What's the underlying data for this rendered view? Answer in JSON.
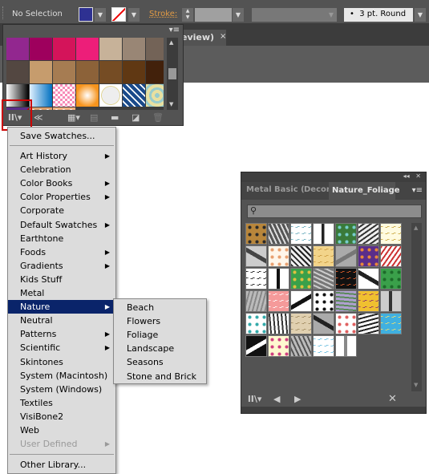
{
  "control_bar": {
    "selection": "No Selection",
    "fill_color": "#2e3192",
    "stroke_label": "Stroke:",
    "brush": "3 pt. Round"
  },
  "document_tab": {
    "title": "eview)",
    "close": "×"
  },
  "swatches_panel": {
    "colors": [
      "#92278f",
      "#9e005d",
      "#d4145a",
      "#ed1e79",
      "#c7b299",
      "#998675",
      "#736357",
      "#534741",
      "#c69c6d",
      "#a67c52",
      "#8c6239",
      "#754c24",
      "#603813",
      "#42210b"
    ],
    "patterns": [
      "gradient-bw",
      "gradient-blue",
      "pink-check",
      "orange-radial",
      "circle-check",
      "blue-floral",
      "foliage",
      "stripe-red",
      "dots-orange",
      "dots-peach"
    ]
  },
  "library_menu": {
    "save": "Save Swatches...",
    "items": [
      {
        "label": "Art History",
        "submenu": true
      },
      {
        "label": "Celebration",
        "submenu": false
      },
      {
        "label": "Color Books",
        "submenu": true
      },
      {
        "label": "Color Properties",
        "submenu": true
      },
      {
        "label": "Corporate",
        "submenu": false
      },
      {
        "label": "Default Swatches",
        "submenu": true
      },
      {
        "label": "Earthtone",
        "submenu": false
      },
      {
        "label": "Foods",
        "submenu": true
      },
      {
        "label": "Gradients",
        "submenu": true
      },
      {
        "label": "Kids Stuff",
        "submenu": false
      },
      {
        "label": "Metal",
        "submenu": false
      },
      {
        "label": "Nature",
        "submenu": true,
        "selected": true
      },
      {
        "label": "Neutral",
        "submenu": false
      },
      {
        "label": "Patterns",
        "submenu": true
      },
      {
        "label": "Scientific",
        "submenu": true
      },
      {
        "label": "Skintones",
        "submenu": false
      },
      {
        "label": "System (Macintosh)",
        "submenu": false
      },
      {
        "label": "System (Windows)",
        "submenu": false
      },
      {
        "label": "Textiles",
        "submenu": false
      },
      {
        "label": "VisiBone2",
        "submenu": false
      },
      {
        "label": "Web",
        "submenu": false
      },
      {
        "label": "User Defined",
        "submenu": true,
        "disabled": true
      }
    ],
    "other": "Other Library..."
  },
  "nature_submenu": [
    "Beach",
    "Flowers",
    "Foliage",
    "Landscape",
    "Seasons",
    "Stone and Brick"
  ],
  "library_panel": {
    "tabs": [
      "Metal",
      "Basic (",
      "Decor",
      "Nature_Foliage"
    ],
    "active_tab": "Nature_Foliage",
    "search_placeholder": "",
    "swatches": [
      [
        "#b8863b",
        "#2a2a2a"
      ],
      [
        "#555",
        "#ddd"
      ],
      [
        "#fff",
        "#6ab"
      ],
      [
        "#fff",
        "#222"
      ],
      [
        "#3a7a3a",
        "#7cc"
      ],
      [
        "#eee",
        "#333"
      ],
      [
        "#fffbe0",
        "#c9a53a"
      ],
      [
        "#ccc",
        "#444"
      ],
      [
        "#fff6ea",
        "#e8a070"
      ],
      [
        "#eee",
        "#222"
      ],
      [
        "#f2d48a",
        "#c99a40"
      ],
      [
        "#aaa",
        "#777"
      ],
      [
        "#5a2d8a",
        "#e8883a"
      ],
      [
        "#fff",
        "#c33"
      ],
      [
        "#fff",
        "#111"
      ],
      [
        "#fff",
        "#111"
      ],
      [
        "#3aa04a",
        "#e0c040"
      ],
      [
        "#777",
        "#ccc"
      ],
      [
        "#111",
        "#e8602a"
      ],
      [
        "#fff",
        "#222"
      ],
      [
        "#3aa04a",
        "#1d6a2a"
      ],
      [
        "#bbb",
        "#888"
      ],
      [
        "#f59a9a",
        "#fff"
      ],
      [
        "#fff",
        "#111"
      ],
      [
        "#fff",
        "#111"
      ],
      [
        "#b0a0d0",
        "#5a8a5a"
      ],
      [
        "#f0c030",
        "#8a2a6a"
      ],
      [
        "#ccc",
        "#333"
      ],
      [
        "#fff",
        "#3aa"
      ],
      [
        "#fff",
        "#333"
      ],
      [
        "#e0d0b0",
        "#a08a60"
      ],
      [
        "#aaa",
        "#222"
      ],
      [
        "#fff",
        "#e06060"
      ],
      [
        "#fff",
        "#222"
      ],
      [
        "#40b0e0",
        "#f0e070"
      ],
      [
        "#111",
        "#fff"
      ],
      [
        "#fff8d0",
        "#d04080"
      ],
      [
        "#bbb",
        "#555"
      ],
      [
        "#fff",
        "#6bd"
      ],
      [
        "#fff",
        "#888"
      ]
    ]
  }
}
